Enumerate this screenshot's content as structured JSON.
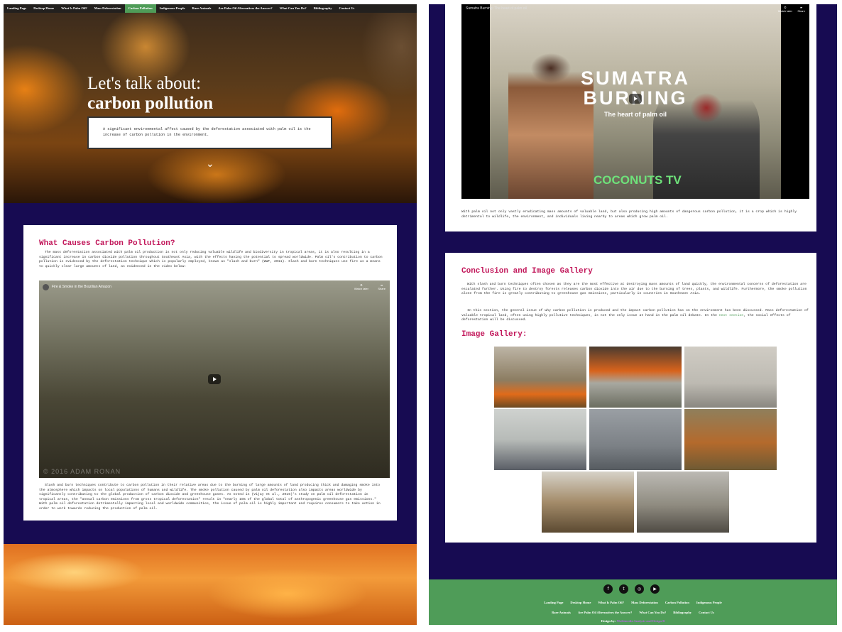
{
  "nav": {
    "items": [
      "Landing Page",
      "Desktop Home",
      "What Is Palm Oil?",
      "Mass Deforestation",
      "Carbon Pollution",
      "Indigenous People",
      "Rare Animals",
      "Are Palm Oil Alternatives the Answer?",
      "What Can You Do?",
      "Bibliography",
      "Contact Us"
    ],
    "active": "Carbon Pollution"
  },
  "hero": {
    "line1": "Let's talk about:",
    "line2": "carbon pollution",
    "summary": "A significant environmental affect caused by the deforestation associated with palm oil is the increase of carbon pollution in the environment.",
    "chevron": "⌄"
  },
  "causes": {
    "heading": "What Causes Carbon Pollution?",
    "p1": "The mass deforestation associated with palm oil production is not only reducing valuable wildlife and biodiversity in tropical areas, it is also resulting in a significant increase in carbon dioxide pollution throughout Southeast Asia, with the effects having the potential to spread worldwide. Palm oil's contribution to carbon pollution is evidenced by the deforestation technique which is popularly employed, known as \"slash and burn\" (WWF, 2011). Slash and burn techniques use fire as a means to quickly clear large amounts of land, as evidenced in the video below:",
    "video_title": "Fire & Smoke in the Brazilian Amazon",
    "video_watermark": "© 2016 ADAM RONAN",
    "watch_later": "Watch later",
    "share": "Share",
    "p2": "Slash and burn techniques contribute to carbon pollution in their relative areas due to the burning of large amounts of land producing thick and damaging smoke into the atmosphere which impacts on local populations of humans and wildlife. The smoke pollution caused by palm oil deforestation also impacts areas worldwide by significantly contributing to the global production of carbon dioxide and greenhouse gases. As noted in (Vijay et al., 2016)'s study on palm oil deforestation in tropical areas, the \"annual carbon emissions from gross tropical deforestation\" result in \"nearly 15% of the global total of anthropogenic greenhouse gas emissions.\" With palm oil deforestation detrimentally impacting local and worldwide communities, the issue of palm oil is highly important and requires consumers to take action in order to work towards reducing the production of palm oil."
  },
  "sumatra": {
    "video_title": "Sumatra Burning: The heart of palm oil",
    "big1": "SUMATRA",
    "big2": "BURNING",
    "tagline": "The heart of palm oil",
    "brand": "COCONUTS TV",
    "watch_later": "Watch later",
    "share": "Share",
    "caption": "With palm oil not only vastly eradicating mass amounts of valuable land, but also producing high amounts of dangerous carbon pollution, it is a crop which is highly detrimental to wildlife, the environment, and individuals living nearby to areas which grow palm oil."
  },
  "conclusion": {
    "heading": "Conclusion and Image Gallery",
    "p1": "With slash and burn techniques often chosen as they are the most effective at destroying mass amounts of land quickly, the environmental concerns of deforestation are escalated further. Using fire to destroy forests releases carbon dioxide into the air due to the burning of trees, plants, and wildlife. Furthermore, the smoke pollution alone from the fire is greatly contributing to greenhouse gas emissions, particularly in countries in Southeast Asia.",
    "p2a": "In this section, the general issue of why carbon pollution is produced and the impact carbon pollution has on the environment has been discussed. Mass deforestation of valuable tropical land, often using highly pollutive techniques, is not the only issue at hand in the palm oil debate. In the",
    "p2link": "next section",
    "p2b": ", the social effects of deforestation will be discussed.",
    "gallery_heading": "Image Gallery:"
  },
  "footer": {
    "social": [
      "f",
      "t",
      "◎",
      "▶"
    ],
    "row1": [
      "Landing Page",
      "Desktop Home",
      "What Is Palm Oil?",
      "Mass Deforestation",
      "Carbon Pollution",
      "Indigenous People"
    ],
    "row2": [
      "Rare Animals",
      "Are Palm Oil Alternatives the Answer?",
      "What Can You Do?",
      "Bibliography",
      "Contact Us"
    ],
    "credit_label": "Design by:",
    "credit_name": "Multimedia Analysis and Design B"
  },
  "colors": {
    "accent": "#c2185b",
    "green": "#4f9c58",
    "navy": "#170b52"
  }
}
